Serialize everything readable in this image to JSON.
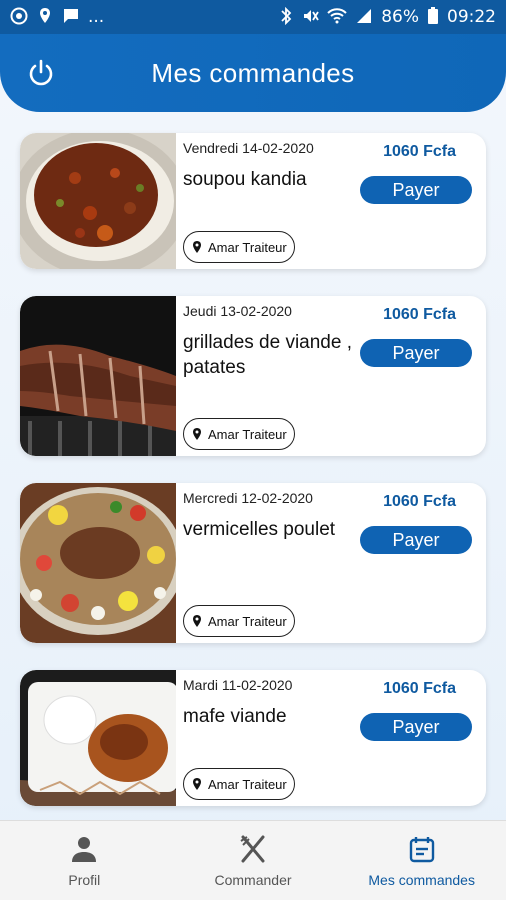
{
  "statusbar": {
    "battery": "86%",
    "time": "09:22",
    "left_icons": [
      "whatsapp-icon",
      "location-icon",
      "message-icon",
      "more-icon"
    ],
    "right_icons": [
      "bluetooth-icon",
      "mute-icon",
      "wifi-icon",
      "signal-icon",
      "battery-icon"
    ],
    "more_dots": "..."
  },
  "header": {
    "title": "Mes commandes",
    "power_icon": "power-icon"
  },
  "orders": [
    {
      "date": "Vendredi 14-02-2020",
      "dish": "soupou kandia",
      "price": "1060 Fcfa",
      "pay_label": "Payer",
      "vendor": "Amar Traiteur"
    },
    {
      "date": "Jeudi 13-02-2020",
      "dish": "grillades de viande , patates",
      "price": "1060 Fcfa",
      "pay_label": "Payer",
      "vendor": "Amar Traiteur"
    },
    {
      "date": "Mercredi 12-02-2020",
      "dish": "vermicelles poulet",
      "price": "1060 Fcfa",
      "pay_label": "Payer",
      "vendor": "Amar Traiteur"
    },
    {
      "date": "Mardi 11-02-2020",
      "dish": "mafe viande",
      "price": "1060 Fcfa",
      "pay_label": "Payer",
      "vendor": "Amar Traiteur"
    }
  ],
  "nav": {
    "items": [
      {
        "label": "Profil",
        "icon": "person-icon"
      },
      {
        "label": "Commander",
        "icon": "fork-knife-icon"
      },
      {
        "label": "Mes commandes",
        "icon": "calendar-icon",
        "active": true
      }
    ]
  },
  "colors": {
    "primary": "#0f5aa0",
    "header": "#136cbf",
    "button": "#0f63b3"
  }
}
